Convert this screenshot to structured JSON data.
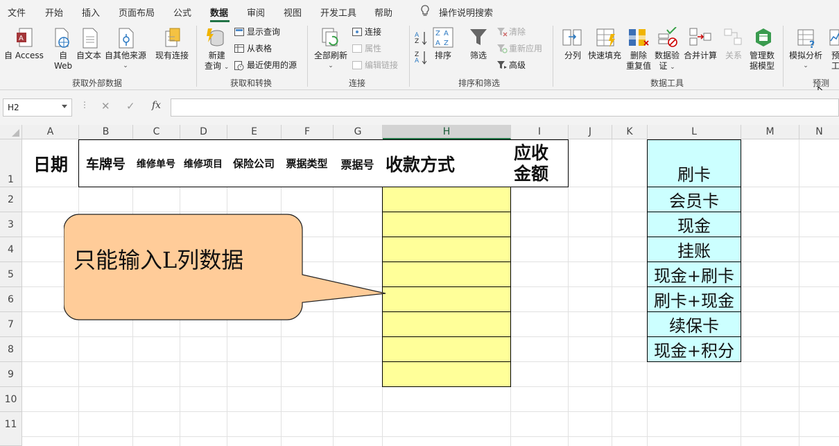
{
  "menu": {
    "items": [
      "文件",
      "开始",
      "插入",
      "页面布局",
      "公式",
      "数据",
      "审阅",
      "视图",
      "开发工具",
      "帮助"
    ],
    "active": "数据",
    "tell_me": "操作说明搜索"
  },
  "ribbon": {
    "get_external": {
      "label": "获取外部数据",
      "access": "自 Access",
      "web_1": "自",
      "web_2": "Web",
      "text": "自文本",
      "other": "自其他来源",
      "existing": "现有连接"
    },
    "get_transform": {
      "label": "获取和转换",
      "new_query_1": "新建",
      "new_query_2": "查询",
      "show_query": "显示查询",
      "from_table": "从表格",
      "recent": "最近使用的源"
    },
    "connections": {
      "label": "连接",
      "refresh_all": "全部刷新",
      "connections": "连接",
      "properties": "属性",
      "edit_links": "编辑链接"
    },
    "sort_filter": {
      "label": "排序和筛选",
      "sort": "排序",
      "filter": "筛选",
      "clear": "清除",
      "reapply": "重新应用",
      "advanced": "高级",
      "az": "A↓Z",
      "za": "Z↓A"
    },
    "data_tools": {
      "label": "数据工具",
      "text_to_columns": "分列",
      "flash_fill": "快速填充",
      "remove_dup_1": "删除",
      "remove_dup_2": "重复值",
      "validation_1": "数据验",
      "validation_2": "证",
      "consolidate": "合并计算",
      "relationships": "关系",
      "data_model_1": "管理数",
      "data_model_2": "据模型"
    },
    "forecast": {
      "label": "预测",
      "what_if": "模拟分析",
      "sheet_1": "预",
      "sheet_2": "工作"
    }
  },
  "formula_bar": {
    "name_box": "H2",
    "cancel": "✕",
    "enter": "✓",
    "fx": "fx",
    "value": ""
  },
  "columns": [
    "A",
    "B",
    "C",
    "D",
    "E",
    "F",
    "G",
    "H",
    "I",
    "J",
    "K",
    "L",
    "M",
    "N"
  ],
  "rows": [
    "1",
    "2",
    "3",
    "4",
    "5",
    "6",
    "7",
    "8",
    "9",
    "10",
    "11"
  ],
  "header_row": {
    "A": "日期",
    "B": "车牌号",
    "C": "维修单号",
    "D": "维修项目",
    "E": "保险公司",
    "F": "票据类型",
    "G": "票据号",
    "H": "收款方式",
    "I_1": "应收",
    "I_2": "金额"
  },
  "list_L": [
    "刷卡",
    "会员卡",
    "现金",
    "挂账",
    "现金+刷卡",
    "刷卡+现金",
    "续保卡",
    "现金+积分"
  ],
  "callout": "只能输入L列数据",
  "colors": {
    "accent": "#217346",
    "input_fill": "#ffff99",
    "list_fill": "#ccffff",
    "callout_fill": "#ffcc99"
  }
}
